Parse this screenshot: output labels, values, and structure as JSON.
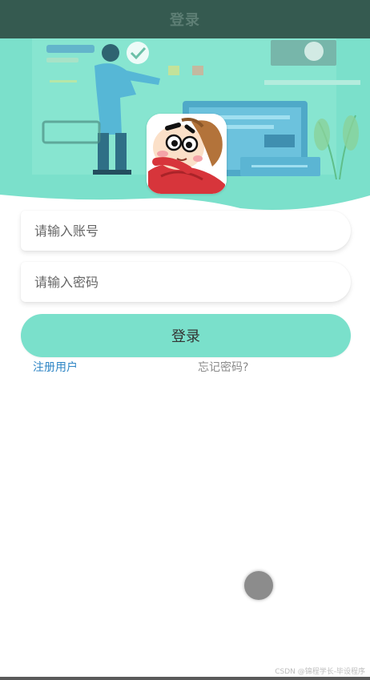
{
  "header": {
    "title": "登录"
  },
  "form": {
    "account_placeholder": "请输入账号",
    "password_placeholder": "请输入密码",
    "login_label": "登录"
  },
  "links": {
    "register": "注册用户",
    "forgot": "忘记密码?"
  },
  "watermark": "CSDN @锦程学长-毕设程序",
  "colors": {
    "header_bg": "#355a50",
    "banner_bg": "#7be0cb",
    "accent_button": "#7ae0cb",
    "link": "#2f86c5"
  },
  "icons": {
    "banner": "illustration-person-presentation",
    "avatar": "cartoon-boy-avatar",
    "floating": "assistive-touch-ball"
  }
}
